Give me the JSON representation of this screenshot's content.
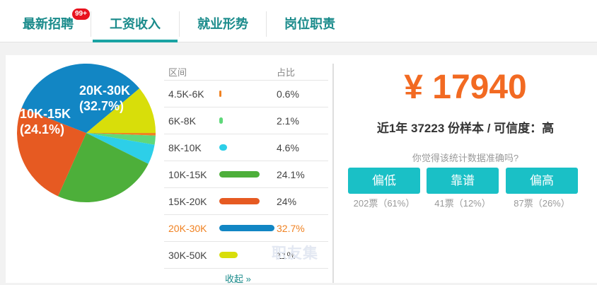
{
  "tabs": [
    {
      "label": "最新招聘"
    },
    {
      "label": "工资收入"
    },
    {
      "label": "就业形势"
    },
    {
      "label": "岗位职责"
    }
  ],
  "badge": "99+",
  "pie": {
    "big_label_1_range": "20K-30K",
    "big_label_1_pct": "(32.7%)",
    "big_label_2_range": "10K-15K",
    "big_label_2_pct": "(24.1%)"
  },
  "table": {
    "col_range": "区间",
    "col_pct": "占比",
    "collapse": "收起 »"
  },
  "chart_data": {
    "type": "pie",
    "categories": [
      "4.5K-6K",
      "6K-8K",
      "8K-10K",
      "10K-15K",
      "15K-20K",
      "20K-30K",
      "30K-50K"
    ],
    "values": [
      0.6,
      2.1,
      4.6,
      24.1,
      24,
      32.7,
      11
    ],
    "labels": [
      "0.6%",
      "2.1%",
      "4.6%",
      "24.1%",
      "24%",
      "32.7%",
      "11%"
    ],
    "colors": [
      "#f08222",
      "#5fd87a",
      "#2dcfe8",
      "#4daf3a",
      "#e65a22",
      "#1286c4",
      "#d8de0a"
    ],
    "highlight_index": 5
  },
  "summary": {
    "salary": "¥ 17940",
    "sample": "近1年 37223 份样本 / 可信度：高",
    "question": "你觉得该统计数据准确吗?"
  },
  "votes": [
    {
      "label": "偏低",
      "count": "202票（61%）"
    },
    {
      "label": "靠谱",
      "count": "41票（12%）"
    },
    {
      "label": "偏高",
      "count": "87票（26%）"
    }
  ],
  "watermark": "职友集"
}
